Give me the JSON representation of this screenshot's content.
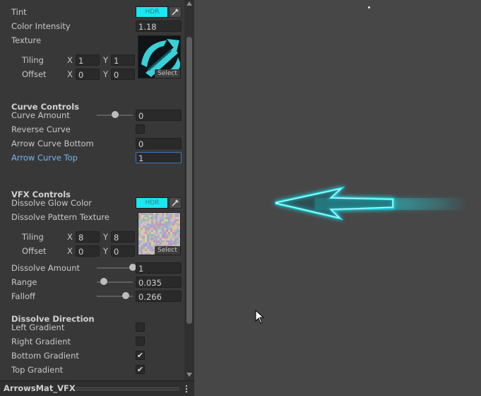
{
  "texture_props": {
    "tint_label": "Tint",
    "tint_hdr": "HDR",
    "color_intensity_label": "Color Intensity",
    "color_intensity_value": "1.18",
    "texture_label": "Texture",
    "tiling_label": "Tiling",
    "tiling_x": "1",
    "tiling_y": "1",
    "offset_label": "Offset",
    "offset_x": "0",
    "offset_y": "0",
    "select_label": "Select"
  },
  "curve_controls": {
    "header": "Curve Controls",
    "curve_amount_label": "Curve Amount",
    "curve_amount_value": "0",
    "curve_amount_level": 0.5,
    "reverse_curve_label": "Reverse Curve",
    "reverse_curve_checked": false,
    "arrow_curve_bottom_label": "Arrow Curve Bottom",
    "arrow_curve_bottom_value": "0",
    "arrow_curve_top_label": "Arrow Curve Top",
    "arrow_curve_top_value": "1"
  },
  "vfx_controls": {
    "header": "VFX Controls",
    "dissolve_glow_color_label": "Dissolve Glow Color",
    "dissolve_glow_hdr": "HDR",
    "dissolve_pattern_texture_label": "Dissolve Pattern Texture",
    "tiling_label": "Tiling",
    "tiling_x": "8",
    "tiling_y": "8",
    "offset_label": "Offset",
    "offset_x": "0",
    "offset_y": "0",
    "select_label": "Select",
    "dissolve_amount_label": "Dissolve Amount",
    "dissolve_amount_value": "1",
    "dissolve_amount_level": 1.0,
    "range_label": "Range",
    "range_value": "0.035",
    "range_level": 0.2,
    "falloff_label": "Falloff",
    "falloff_value": "0.266",
    "falloff_level": 0.8
  },
  "dissolve_direction": {
    "header": "Dissolve Direction",
    "left_gradient_label": "Left Gradient",
    "left_gradient_checked": false,
    "right_gradient_label": "Right Gradient",
    "right_gradient_checked": false,
    "bottom_gradient_label": "Bottom Gradient",
    "bottom_gradient_checked": true,
    "top_gradient_label": "Top Gradient",
    "top_gradient_checked": true
  },
  "footer": {
    "material_name": "ArrowsMat_VFX"
  },
  "axis": {
    "x": "X",
    "y": "Y"
  },
  "icons": {
    "eyedropper": "eyedropper-icon",
    "kebab": "kebab-menu-icon",
    "scroll_up": "scroll-up-arrow-icon",
    "scroll_down": "scroll-down-arrow-icon",
    "cursor": "mouse-cursor-icon"
  },
  "colors": {
    "tint": "#19e8f2",
    "dissolve_glow": "#19e8f2",
    "arrow_glow": "#1fe3ee",
    "active_label": "#7ab3f0"
  }
}
